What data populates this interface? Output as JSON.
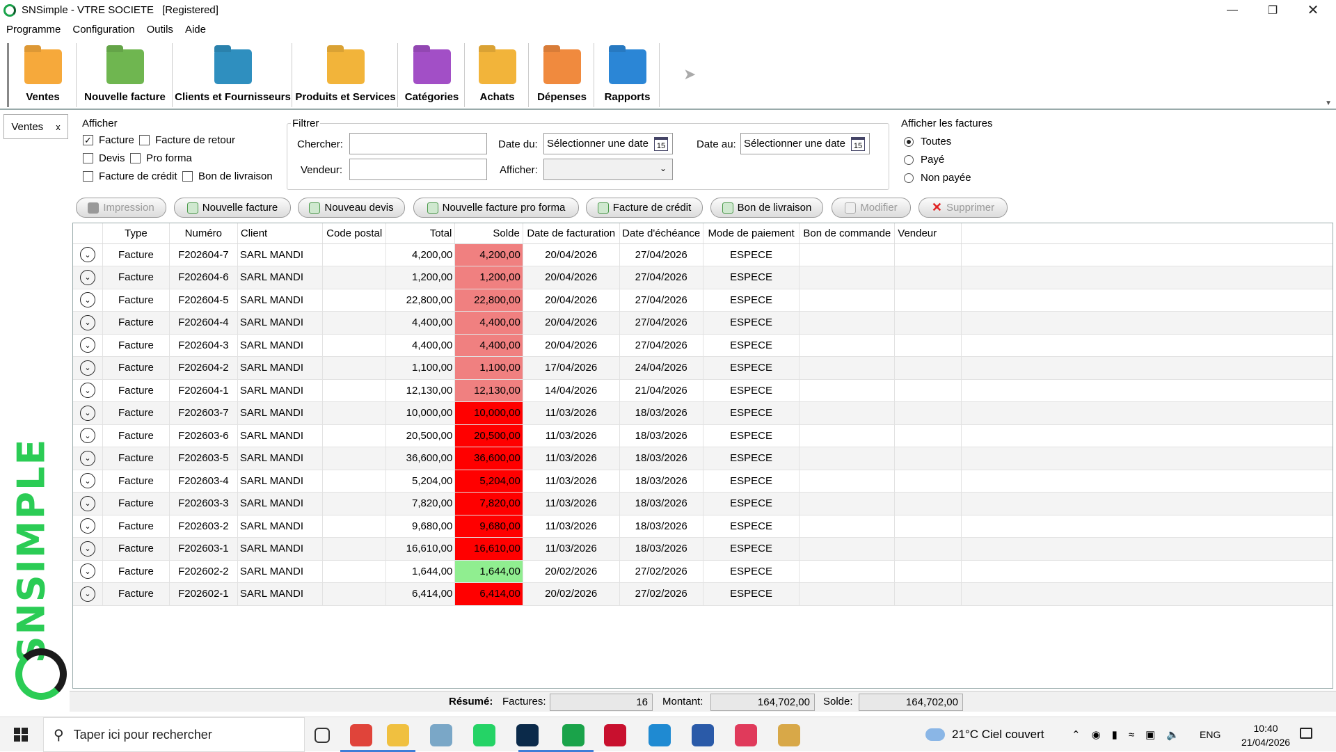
{
  "window": {
    "title": "SNSimple - VTRE SOCIETE",
    "status_tag": "[Registered]"
  },
  "menu": [
    "Programme",
    "Configuration",
    "Outils",
    "Aide"
  ],
  "ribbon": {
    "items": [
      {
        "label": "Ventes",
        "icon": "sales-folder-icon",
        "color": "#f6a93b"
      },
      {
        "label": "Nouvelle facture",
        "icon": "new-invoice-folder-icon",
        "color": "#6fb650"
      },
      {
        "label": "Clients et Fournisseurs",
        "icon": "clients-folder-icon",
        "color": "#2f8fbf"
      },
      {
        "label": "Produits et Services",
        "icon": "products-folder-icon",
        "color": "#f2b43a"
      },
      {
        "label": "Catégories",
        "icon": "categories-folder-icon",
        "color": "#a24fc6"
      },
      {
        "label": "Achats",
        "icon": "purchases-folder-icon",
        "color": "#f2b43a"
      },
      {
        "label": "Dépenses",
        "icon": "expenses-folder-icon",
        "color": "#f08a3e"
      },
      {
        "label": "Rapports",
        "icon": "reports-folder-icon",
        "color": "#2b86d6"
      }
    ]
  },
  "tab": {
    "label": "Ventes",
    "close": "x"
  },
  "afficher": {
    "title": "Afficher",
    "options": [
      {
        "label": "Facture",
        "checked": true
      },
      {
        "label": "Facture de retour",
        "checked": false
      },
      {
        "label": "Devis",
        "checked": false
      },
      {
        "label": "Pro forma",
        "checked": false
      },
      {
        "label": "Facture de crédit",
        "checked": false
      },
      {
        "label": "Bon de livraison",
        "checked": false
      }
    ]
  },
  "filtre": {
    "title": "Filtrer",
    "chercher_label": "Chercher:",
    "chercher_value": "",
    "vendeur_label": "Vendeur:",
    "vendeur_value": "",
    "date_du_label": "Date du:",
    "date_du_value": "Sélectionner une date",
    "date_au_label": "Date au:",
    "date_au_value": "Sélectionner une date",
    "afficher_label": "Afficher:",
    "afficher_value": "",
    "calendar_day": "15"
  },
  "afficher_factures": {
    "title": "Afficher les factures",
    "options": [
      {
        "label": "Toutes",
        "selected": true
      },
      {
        "label": "Payé",
        "selected": false
      },
      {
        "label": "Non payée",
        "selected": false
      }
    ]
  },
  "toolbar": [
    {
      "label": "Impression",
      "enabled": false,
      "icon": "printer-icon"
    },
    {
      "label": "Nouvelle facture",
      "enabled": true,
      "icon": "add-document-icon"
    },
    {
      "label": "Nouveau devis",
      "enabled": true,
      "icon": "add-document-icon"
    },
    {
      "label": "Nouvelle facture pro forma",
      "enabled": true,
      "icon": "add-document-icon"
    },
    {
      "label": "Facture de crédit",
      "enabled": true,
      "icon": "add-document-icon"
    },
    {
      "label": "Bon de livraison",
      "enabled": true,
      "icon": "add-document-icon"
    },
    {
      "label": "Modifier",
      "enabled": false,
      "icon": "edit-icon"
    },
    {
      "label": "Supprimer",
      "enabled": false,
      "icon": "delete-icon"
    }
  ],
  "table": {
    "columns": [
      "",
      "Type",
      "Numéro",
      "Client",
      "Code postal",
      "Total",
      "Solde",
      "Date de facturation",
      "Date d'échéance",
      "Mode de paiement",
      "Bon de commande",
      "Vendeur"
    ],
    "status_colors": {
      "recent": "#f08080",
      "overdue": "#ff0000",
      "partial": "#90ee90"
    },
    "rows": [
      {
        "type": "Facture",
        "numero": "F202604-7",
        "client": "SARL MANDI",
        "code_postal": "",
        "total": "4,200,00",
        "solde": "4,200,00",
        "status": "recent",
        "date_fact": "20/04/2026",
        "date_ech": "27/04/2026",
        "mode": "ESPECE",
        "bon": "",
        "vendeur": ""
      },
      {
        "type": "Facture",
        "numero": "F202604-6",
        "client": "SARL MANDI",
        "code_postal": "",
        "total": "1,200,00",
        "solde": "1,200,00",
        "status": "recent",
        "date_fact": "20/04/2026",
        "date_ech": "27/04/2026",
        "mode": "ESPECE",
        "bon": "",
        "vendeur": ""
      },
      {
        "type": "Facture",
        "numero": "F202604-5",
        "client": "SARL MANDI",
        "code_postal": "",
        "total": "22,800,00",
        "solde": "22,800,00",
        "status": "recent",
        "date_fact": "20/04/2026",
        "date_ech": "27/04/2026",
        "mode": "ESPECE",
        "bon": "",
        "vendeur": ""
      },
      {
        "type": "Facture",
        "numero": "F202604-4",
        "client": "SARL MANDI",
        "code_postal": "",
        "total": "4,400,00",
        "solde": "4,400,00",
        "status": "recent",
        "date_fact": "20/04/2026",
        "date_ech": "27/04/2026",
        "mode": "ESPECE",
        "bon": "",
        "vendeur": ""
      },
      {
        "type": "Facture",
        "numero": "F202604-3",
        "client": "SARL MANDI",
        "code_postal": "",
        "total": "4,400,00",
        "solde": "4,400,00",
        "status": "recent",
        "date_fact": "20/04/2026",
        "date_ech": "27/04/2026",
        "mode": "ESPECE",
        "bon": "",
        "vendeur": ""
      },
      {
        "type": "Facture",
        "numero": "F202604-2",
        "client": "SARL MANDI",
        "code_postal": "",
        "total": "1,100,00",
        "solde": "1,100,00",
        "status": "recent",
        "date_fact": "17/04/2026",
        "date_ech": "24/04/2026",
        "mode": "ESPECE",
        "bon": "",
        "vendeur": ""
      },
      {
        "type": "Facture",
        "numero": "F202604-1",
        "client": "SARL MANDI",
        "code_postal": "",
        "total": "12,130,00",
        "solde": "12,130,00",
        "status": "recent",
        "date_fact": "14/04/2026",
        "date_ech": "21/04/2026",
        "mode": "ESPECE",
        "bon": "",
        "vendeur": ""
      },
      {
        "type": "Facture",
        "numero": "F202603-7",
        "client": "SARL MANDI",
        "code_postal": "",
        "total": "10,000,00",
        "solde": "10,000,00",
        "status": "overdue",
        "date_fact": "11/03/2026",
        "date_ech": "18/03/2026",
        "mode": "ESPECE",
        "bon": "",
        "vendeur": ""
      },
      {
        "type": "Facture",
        "numero": "F202603-6",
        "client": "SARL MANDI",
        "code_postal": "",
        "total": "20,500,00",
        "solde": "20,500,00",
        "status": "overdue",
        "date_fact": "11/03/2026",
        "date_ech": "18/03/2026",
        "mode": "ESPECE",
        "bon": "",
        "vendeur": ""
      },
      {
        "type": "Facture",
        "numero": "F202603-5",
        "client": "SARL MANDI",
        "code_postal": "",
        "total": "36,600,00",
        "solde": "36,600,00",
        "status": "overdue",
        "date_fact": "11/03/2026",
        "date_ech": "18/03/2026",
        "mode": "ESPECE",
        "bon": "",
        "vendeur": ""
      },
      {
        "type": "Facture",
        "numero": "F202603-4",
        "client": "SARL MANDI",
        "code_postal": "",
        "total": "5,204,00",
        "solde": "5,204,00",
        "status": "overdue",
        "date_fact": "11/03/2026",
        "date_ech": "18/03/2026",
        "mode": "ESPECE",
        "bon": "",
        "vendeur": ""
      },
      {
        "type": "Facture",
        "numero": "F202603-3",
        "client": "SARL MANDI",
        "code_postal": "",
        "total": "7,820,00",
        "solde": "7,820,00",
        "status": "overdue",
        "date_fact": "11/03/2026",
        "date_ech": "18/03/2026",
        "mode": "ESPECE",
        "bon": "",
        "vendeur": ""
      },
      {
        "type": "Facture",
        "numero": "F202603-2",
        "client": "SARL MANDI",
        "code_postal": "",
        "total": "9,680,00",
        "solde": "9,680,00",
        "status": "overdue",
        "date_fact": "11/03/2026",
        "date_ech": "18/03/2026",
        "mode": "ESPECE",
        "bon": "",
        "vendeur": ""
      },
      {
        "type": "Facture",
        "numero": "F202603-1",
        "client": "SARL MANDI",
        "code_postal": "",
        "total": "16,610,00",
        "solde": "16,610,00",
        "status": "overdue",
        "date_fact": "11/03/2026",
        "date_ech": "18/03/2026",
        "mode": "ESPECE",
        "bon": "",
        "vendeur": ""
      },
      {
        "type": "Facture",
        "numero": "F202602-2",
        "client": "SARL MANDI",
        "code_postal": "",
        "total": "1,644,00",
        "solde": "1,644,00",
        "status": "partial",
        "date_fact": "20/02/2026",
        "date_ech": "27/02/2026",
        "mode": "ESPECE",
        "bon": "",
        "vendeur": ""
      },
      {
        "type": "Facture",
        "numero": "F202602-1",
        "client": "SARL MANDI",
        "code_postal": "",
        "total": "6,414,00",
        "solde": "6,414,00",
        "status": "overdue",
        "date_fact": "20/02/2026",
        "date_ech": "27/02/2026",
        "mode": "ESPECE",
        "bon": "",
        "vendeur": ""
      }
    ]
  },
  "summary": {
    "resume_label": "Résumé:",
    "factures_label": "Factures:",
    "factures_value": "16",
    "montant_label": "Montant:",
    "montant_value": "164,702,00",
    "solde_label": "Solde:",
    "solde_value": "164,702,00"
  },
  "brand": {
    "text": "SNSIMPLE"
  },
  "taskbar": {
    "search_placeholder": "Taper ici pour rechercher",
    "weather": "21°C  Ciel couvert",
    "lang": "ENG",
    "time": "10:40",
    "date": "21/04/2026",
    "apps": [
      {
        "name": "task-view-icon",
        "color": "#333"
      },
      {
        "name": "chrome-icon",
        "color": "#e0443a"
      },
      {
        "name": "file-explorer-icon",
        "color": "#f0c040"
      },
      {
        "name": "app-icon",
        "color": "#7aa7c7"
      },
      {
        "name": "whatsapp-icon",
        "color": "#25d366"
      },
      {
        "name": "photoshop-icon",
        "color": "#0b2a4a"
      },
      {
        "name": "snsimple-taskbar-icon",
        "color": "#1aa34a"
      },
      {
        "name": "recorder-icon",
        "color": "#c8102e"
      },
      {
        "name": "vscode-icon",
        "color": "#1f8ad2"
      },
      {
        "name": "powershell-icon",
        "color": "#2a5aa8"
      },
      {
        "name": "snipping-tool-icon",
        "color": "#e03a5b"
      },
      {
        "name": "paint-icon",
        "color": "#d8a848"
      }
    ]
  }
}
